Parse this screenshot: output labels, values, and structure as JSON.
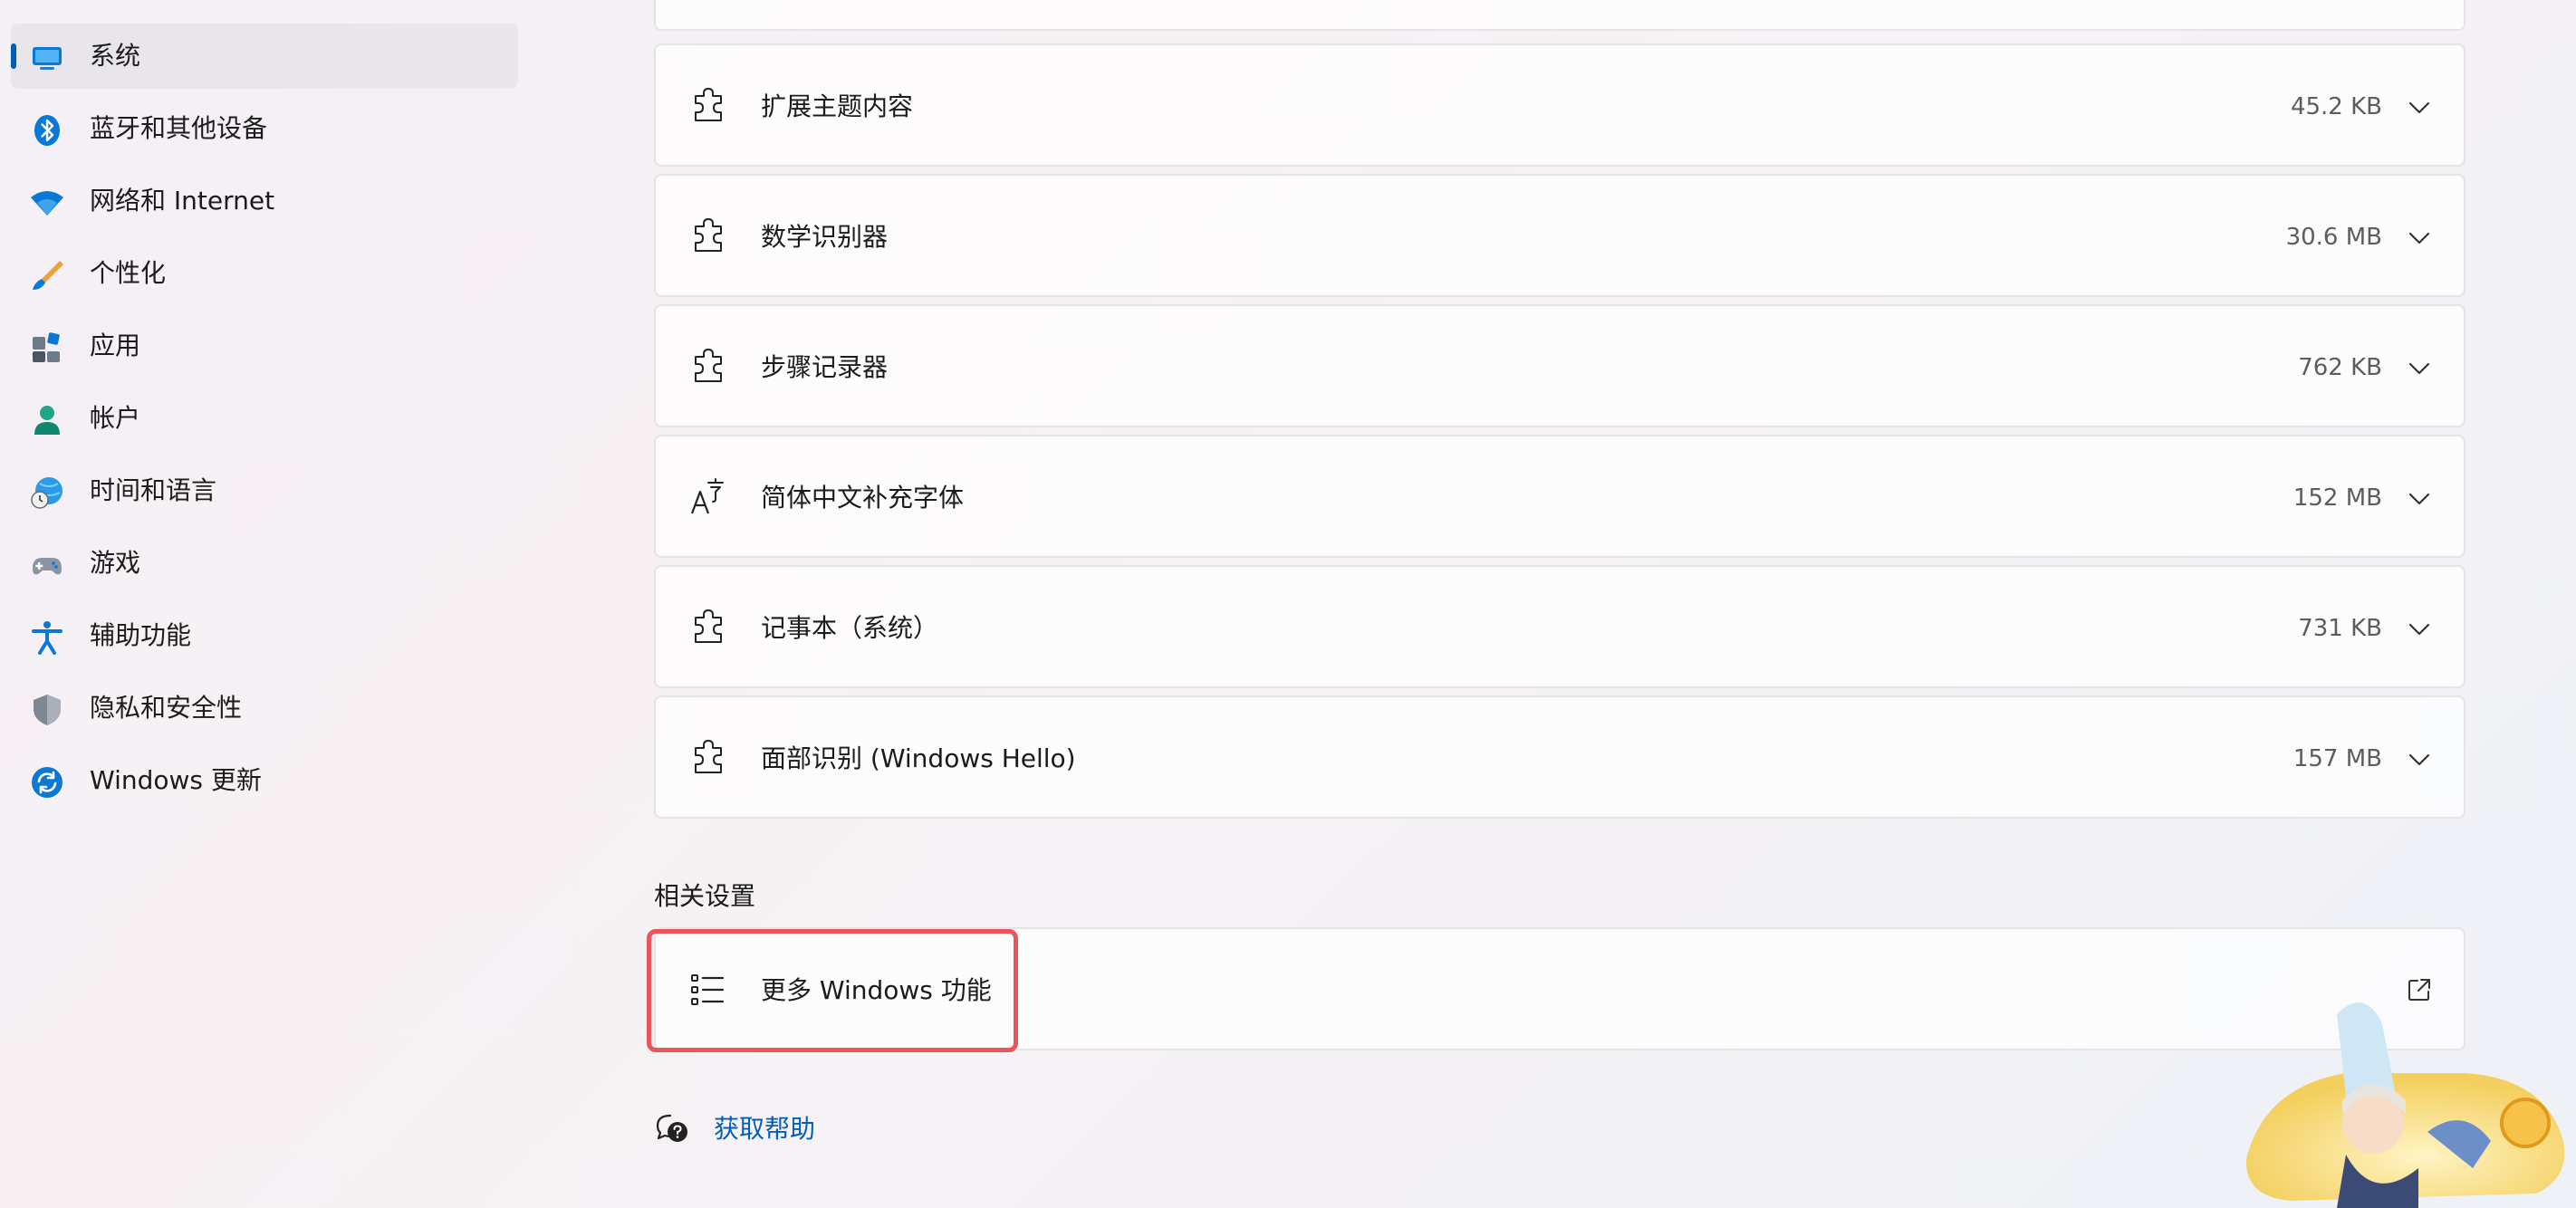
{
  "sidebar": {
    "items": [
      {
        "label": "系统",
        "icon": "monitor-icon",
        "selected": true
      },
      {
        "label": "蓝牙和其他设备",
        "icon": "bluetooth-icon"
      },
      {
        "label": "网络和 Internet",
        "icon": "wifi-icon"
      },
      {
        "label": "个性化",
        "icon": "brush-icon"
      },
      {
        "label": "应用",
        "icon": "apps-icon"
      },
      {
        "label": "帐户",
        "icon": "account-icon"
      },
      {
        "label": "时间和语言",
        "icon": "globe-clock-icon"
      },
      {
        "label": "游戏",
        "icon": "gamepad-icon"
      },
      {
        "label": "辅助功能",
        "icon": "accessibility-icon"
      },
      {
        "label": "隐私和安全性",
        "icon": "shield-icon"
      },
      {
        "label": "Windows 更新",
        "icon": "update-icon"
      }
    ]
  },
  "features": [
    {
      "label": "扩展主题内容",
      "size": "45.2 KB",
      "icon": "puzzle-icon"
    },
    {
      "label": "数学识别器",
      "size": "30.6 MB",
      "icon": "puzzle-icon"
    },
    {
      "label": "步骤记录器",
      "size": "762 KB",
      "icon": "puzzle-icon"
    },
    {
      "label": "简体中文补充字体",
      "size": "152 MB",
      "icon": "font-icon"
    },
    {
      "label": "记事本（系统）",
      "size": "731 KB",
      "icon": "puzzle-icon"
    },
    {
      "label": "面部识别 (Windows Hello)",
      "size": "157 MB",
      "icon": "puzzle-icon"
    }
  ],
  "related": {
    "title": "相关设置",
    "more_features_label": "更多 Windows 功能"
  },
  "help": {
    "label": "获取帮助"
  },
  "colors": {
    "accent": "#005fb8",
    "highlight": "#e8555a"
  }
}
